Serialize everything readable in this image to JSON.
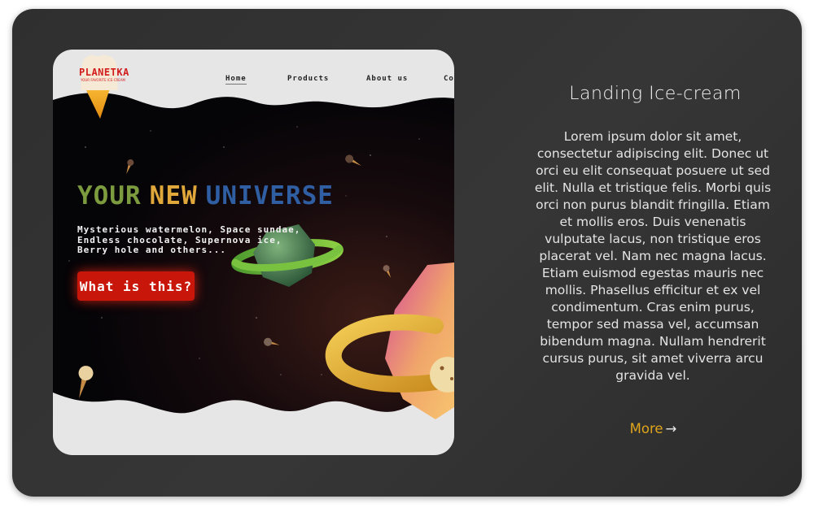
{
  "preview": {
    "brand": {
      "name": "PLANETKA",
      "tagline": "YOUR FAVORITE ICE-CREAM"
    },
    "nav": [
      "Home",
      "Products",
      "About us",
      "Co"
    ],
    "headline": {
      "words": [
        "YOUR",
        "NEW",
        "UNIVERSE"
      ],
      "colors": [
        "#7c9a3e",
        "#e0a73a",
        "#2f5ea3"
      ]
    },
    "tagline_lines": [
      "Mysterious watermelon, Space sundae,",
      "Endless chocolate, Supernova ice,",
      "Berry hole and others..."
    ],
    "cta_label": "What is this?"
  },
  "info": {
    "title": "Landing Ice-cream",
    "description": "Lorem ipsum dolor sit amet, consectetur adipiscing elit. Donec ut orci eu elit consequat posuere ut sed elit. Nulla et tristique felis. Morbi quis orci non purus blandit fringilla. Etiam et mollis eros. Duis venenatis vulputate lacus, non tristique eros placerat vel. Nam nec magna lacus. Etiam euismod egestas mauris nec mollis. Phasellus efficitur et ex vel condimentum. Cras enim purus, tempor sed massa vel, accumsan bibendum magna. Nullam hendrerit cursus purus, sit amet viverra arcu gravida vel.",
    "more_label": "More",
    "more_icon": "arrow-right-icon",
    "accent_color": "#e0a51b"
  }
}
